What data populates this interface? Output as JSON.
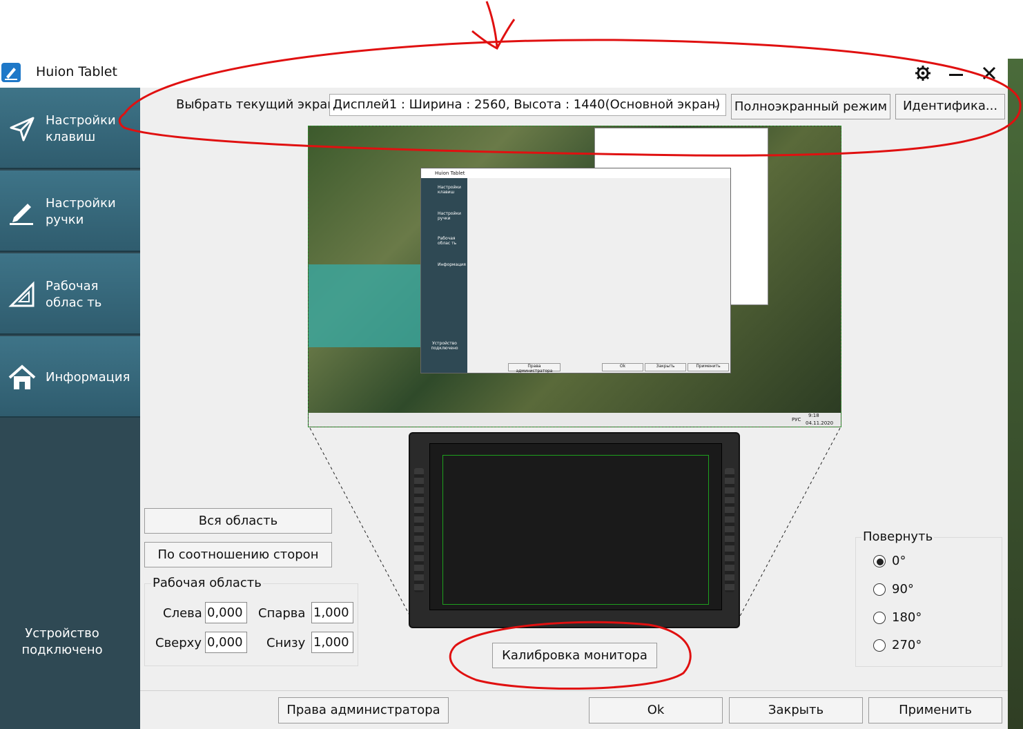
{
  "window": {
    "title": "Huion Tablet"
  },
  "sidebar": {
    "items": [
      {
        "label": "Настройки клавиш",
        "icon": "send-arrow-icon"
      },
      {
        "label": "Настройки ручки",
        "icon": "pen-icon"
      },
      {
        "label": "Рабочая облас ть",
        "icon": "set-square-icon"
      },
      {
        "label": "Информация",
        "icon": "home-icon"
      }
    ],
    "device_status": "Устройство подключено"
  },
  "screen_select": {
    "label": "Выбрать текущий экран",
    "value": "Дисплей1 : Ширина : 2560, Высота : 1440(Основной экран)",
    "fullscreen_label": "Полноэкранный режим",
    "identify_label": "Идентифика..."
  },
  "preview": {
    "mini_window_title": "Huion Tablet",
    "mini_sidebar": [
      "Настройки клавиш",
      "Настройки ручки",
      "Рабочая облас ть",
      "Информация"
    ],
    "mini_device_status": "Устройство подключено",
    "mini_buttons": [
      "Права администратора",
      "Ok",
      "Закрыть",
      "Применить"
    ],
    "taskbar_time": "9:18",
    "taskbar_date": "04.11.2020",
    "taskbar_lang": "РУС"
  },
  "area_buttons": {
    "full_area": "Вся область",
    "aspect_ratio": "По соотношению сторон"
  },
  "work_area": {
    "title": "Рабочая область",
    "left_label": "Слева",
    "left_value": "0,000",
    "right_label": "Спарва",
    "right_value": "1,000",
    "top_label": "Сверху",
    "top_value": "0,000",
    "bottom_label": "Снизу",
    "bottom_value": "1,000"
  },
  "calibrate_label": "Калибровка монитора",
  "rotate": {
    "title": "Повернуть",
    "options": [
      "0°",
      "90°",
      "180°",
      "270°"
    ],
    "selected": "0°"
  },
  "footer": {
    "admin_label": "Права администратора",
    "ok_label": "Ok",
    "close_label": "Закрыть",
    "apply_label": "Применить"
  },
  "colors": {
    "sidebar": "#2f4954",
    "nav_item": "#3e7488",
    "annotation": "#e01010",
    "active_area": "#1ea01e"
  }
}
